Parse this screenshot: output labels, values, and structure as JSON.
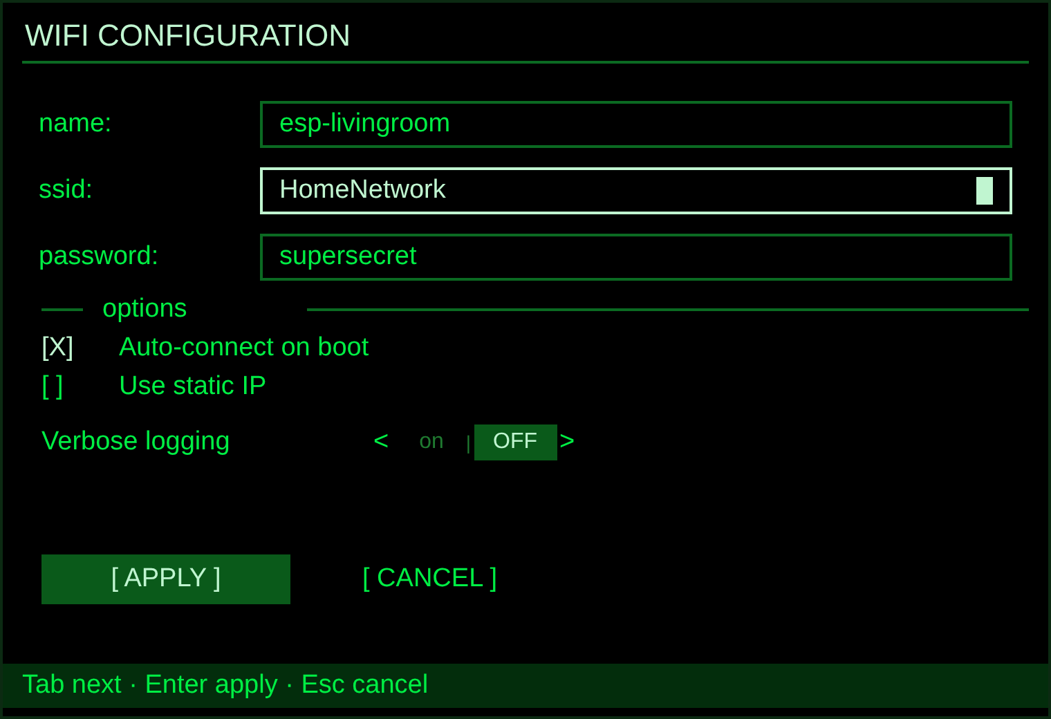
{
  "window": {
    "title": "WIFI CONFIGURATION"
  },
  "fields": [
    {
      "label": "name:",
      "value": "esp-livingroom",
      "focused": false
    },
    {
      "label": "ssid:",
      "value": "HomeNetwork",
      "focused": true
    },
    {
      "label": "password:",
      "value": "supersecret",
      "focused": false
    }
  ],
  "options": {
    "title": "options",
    "checkboxes": [
      {
        "box": "[X]",
        "label": "Auto-connect on boot",
        "checked": true
      },
      {
        "box": "[ ]",
        "label": "Use static IP",
        "checked": false
      }
    ],
    "toggle": {
      "label": "Verbose logging",
      "prev": "<",
      "next": ">",
      "separator": "|",
      "choices": [
        {
          "label": "on",
          "selected": false
        },
        {
          "label": "OFF",
          "selected": true
        }
      ]
    }
  },
  "buttons": [
    {
      "label": "[ APPLY ]",
      "selected": true
    },
    {
      "label": "[ CANCEL ]",
      "selected": false
    }
  ],
  "status_bar": "Tab next · Enter apply · Esc cancel"
}
